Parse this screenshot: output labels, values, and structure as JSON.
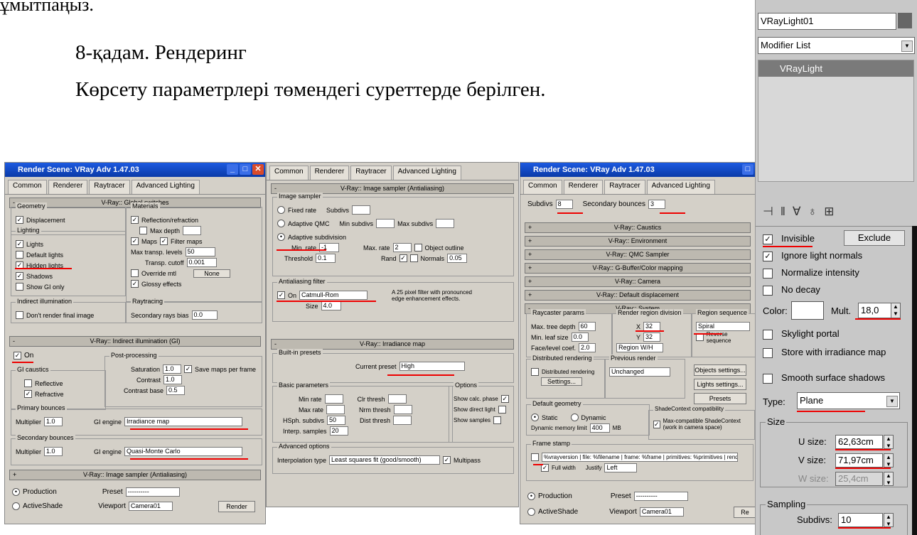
{
  "doc": {
    "top_fragment": "ұмытпаңыз.",
    "step_title": "8-қадам. Рендеринг",
    "step_desc": "Көрсету параметрлері төмендегі суреттерде берілген."
  },
  "shot1": {
    "title": "Render Scene: VRay Adv 1.47.03",
    "tabs": [
      "Common",
      "Renderer",
      "Raytracer",
      "Advanced Lighting"
    ],
    "rollout_global": "V-Ray:: Global switches",
    "geometry_label": "Geometry",
    "displacement": "Displacement",
    "lighting_label": "Lighting",
    "lights": "Lights",
    "default_lights": "Default lights",
    "hidden_lights": "Hidden lights",
    "shadows": "Shadows",
    "show_gi_only": "Show GI only",
    "materials_label": "Materials",
    "reflection_refraction": "Reflection/refraction",
    "max_depth": "Max depth",
    "maps": "Maps",
    "filter_maps": "Filter maps",
    "max_transp_levels": "Max transp. levels",
    "max_transp_value": "50",
    "transp_cutoff": "Transp. cutoff",
    "transp_cutoff_value": "0.001",
    "override_mtl": "Override mtl",
    "glossy_effects": "Glossy effects",
    "none_btn": "None",
    "indirect_label": "Indirect illumination",
    "dont_render_final": "Don't render final image",
    "raytracing_label": "Raytracing",
    "secondary_rays_bias": "Secondary rays bias",
    "secondary_rays_value": "0.0",
    "rollout_indirect": "V-Ray:: Indirect illumination (GI)",
    "on": "On",
    "gi_caustics": "GI caustics",
    "reflective": "Reflective",
    "refractive": "Refractive",
    "post_processing": "Post-processing",
    "saturation": "Saturation",
    "contrast": "Contrast",
    "contrast_base": "Contrast base",
    "save_maps": "Save maps per frame",
    "sat_val": "1.0",
    "con_val": "1.0",
    "cb_val": "0.5",
    "primary_bounces": "Primary bounces",
    "secondary_bounces": "Secondary bounces",
    "multiplier": "Multiplier",
    "mult_val": "1.0",
    "gi_engine": "GI engine",
    "primary_engine": "Irradiance map",
    "secondary_engine": "Quasi-Monte Carlo",
    "rollout_sampler": "V-Ray:: Image sampler (Antialiasing)",
    "production": "Production",
    "activeshade": "ActiveShade",
    "preset": "Preset",
    "viewport": "Viewport",
    "viewport_val": "Camera01",
    "render_btn": "Render"
  },
  "shot2": {
    "tabs": [
      "Common",
      "Renderer",
      "Raytracer",
      "Advanced Lighting"
    ],
    "rollout_sampler": "V-Ray:: Image sampler (Antialiasing)",
    "image_sampler": "Image sampler",
    "fixed_rate": "Fixed rate",
    "subdivs": "Subdivs",
    "adaptive_qmc": "Adaptive QMC",
    "min_subdivs": "Min subdivs",
    "max_subdivs": "Max subdivs",
    "adaptive_subdivision": "Adaptive subdivision",
    "min_rate": "Min. rate",
    "max_rate": "Max. rate",
    "threshold": "Threshold",
    "rand": "Rand",
    "object_outline": "Object outline",
    "normals": "Normals",
    "min_rate_val": "-1",
    "max_rate_val": "2",
    "threshold_val": "0.1",
    "normals_val": "0.05",
    "aa_filter": "Antialiasing filter",
    "filter_on": "On",
    "filter_name": "Catmull-Rom",
    "filter_desc": "A 25 pixel filter with pronounced edge enhancement effects.",
    "size": "Size",
    "size_val": "4.0",
    "rollout_irradiance": "V-Ray:: Irradiance map",
    "built_in_presets": "Built-in presets",
    "current_preset": "Current preset",
    "current_preset_val": "High",
    "basic_params": "Basic parameters",
    "min_rate2": "Min rate",
    "max_rate2": "Max rate",
    "hsph_subdivs": "HSph. subdivs",
    "interp_samples": "Interp. samples",
    "clr_thresh": "Clr thresh",
    "nrm_thresh": "Nrm thresh",
    "dist_thresh": "Dist thresh",
    "hsph_val": "50",
    "interp_val": "20",
    "options": "Options",
    "show_calc_phase": "Show calc. phase",
    "show_direct_light": "Show direct light",
    "show_samples": "Show samples",
    "advanced_options": "Advanced options",
    "interpolation_type": "Interpolation type",
    "interp_type_val": "Least squares fit (good/smooth)",
    "multipass": "Multipass"
  },
  "shot3": {
    "title": "Render Scene: VRay Adv 1.47.03",
    "tabs": [
      "Common",
      "Renderer",
      "Raytracer",
      "Advanced Lighting"
    ],
    "subdivs": "Subdivs",
    "subdivs_val": "8",
    "secondary_bounces": "Secondary bounces",
    "sec_bounces_val": "3",
    "rollouts": [
      "V-Ray:: Caustics",
      "V-Ray:: Environment",
      "V-Ray:: QMC Sampler",
      "V-Ray:: G-Buffer/Color mapping",
      "V-Ray:: Camera",
      "V-Ray:: Default displacement",
      "V-Ray:: System"
    ],
    "raycaster": "Raycaster params",
    "max_tree_depth": "Max. tree depth",
    "min_leaf_size": "Min. leaf size",
    "face_level_coef": "Face/level coef.",
    "tree_val": "60",
    "leaf_val": "0.0",
    "face_val": "2.0",
    "render_region": "Render region division",
    "x": "X",
    "y": "Y",
    "x_val": "32",
    "y_val": "32",
    "region_wh": "Region W/H",
    "region_sequence": "Region sequence",
    "region_seq_val": "Spiral",
    "reverse_sequence": "Reverse sequence",
    "distributed": "Distributed rendering",
    "distributed_cb": "Distributed rendering",
    "settings_btn": "Settings...",
    "previous_render": "Previous render",
    "unchanged": "Unchanged",
    "objects_settings": "Objects settings...",
    "lights_settings": "Lights settings...",
    "presets": "Presets",
    "default_geometry": "Default geometry",
    "static": "Static",
    "dynamic": "Dynamic",
    "dyn_mem_limit": "Dynamic memory limit",
    "dyn_mem_val": "400",
    "mb": "MB",
    "shade_context": "ShadeContext compatibility",
    "max_compat": "Max-compatible ShadeContext (work in camera space)",
    "frame_stamp": "Frame stamp",
    "stamp_text": "%vrayversion | file: %filename | frame: %frame | primitives: %primitives | render time: %rendertime",
    "full_width": "Full width",
    "justify": "Justify",
    "justify_val": "Left",
    "production": "Production",
    "activeshade": "ActiveShade",
    "preset": "Preset",
    "viewport": "Viewport",
    "viewport_val": "Camera01",
    "render_btn": "Re"
  },
  "panel": {
    "object_name": "VRayLight01",
    "modifier_list": "Modifier List",
    "stack_item": "VRayLight",
    "invisible": "Invisible",
    "exclude": "Exclude",
    "ignore_normals": "Ignore light normals",
    "normalize": "Normalize intensity",
    "no_decay": "No decay",
    "color": "Color:",
    "mult": "Mult.",
    "mult_val": "18,0",
    "skylight_portal": "Skylight portal",
    "store_irradiance": "Store with irradiance map",
    "smooth_shadows": "Smooth surface shadows",
    "type": "Type:",
    "type_val": "Plane",
    "size_group": "Size",
    "u_size": "U size:",
    "u_val": "62,63cm",
    "v_size": "V size:",
    "v_val": "71,97cm",
    "w_size": "W size:",
    "w_val": "25,4cm",
    "sampling_group": "Sampling",
    "subdivs": "Subdivs:",
    "subdivs_val": "10"
  }
}
